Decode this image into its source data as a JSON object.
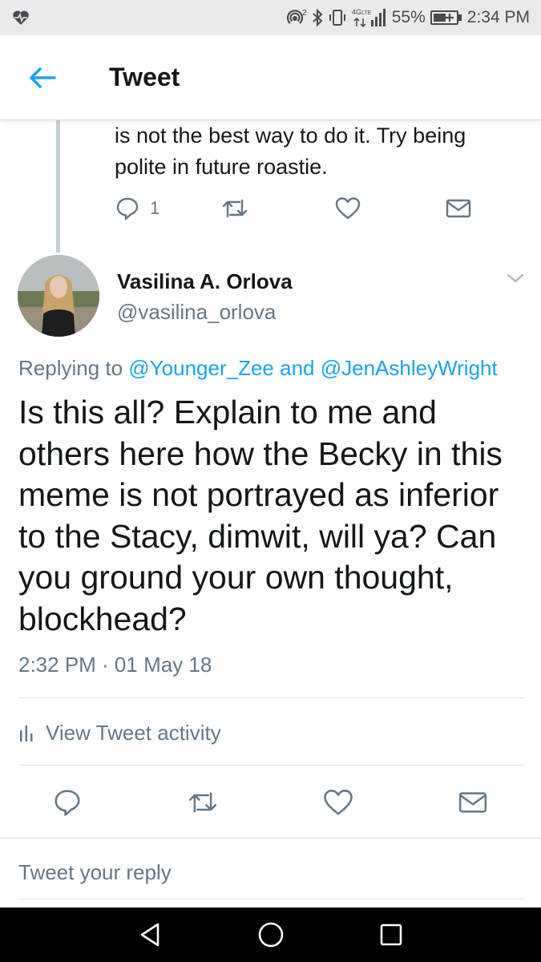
{
  "status_bar": {
    "network": "4G LTE",
    "battery": "55%",
    "time": "2:34 PM",
    "left_icon": "heart-pulse-icon"
  },
  "header": {
    "title": "Tweet",
    "back_icon": "arrow-left-icon"
  },
  "previous_tweet": {
    "text_line1": "is not the best way to do it. Try being",
    "text_line2": "polite in future roastie.",
    "reply_count": "1"
  },
  "tweet": {
    "author_name": "Vasilina A. Orlova",
    "author_handle": "@vasilina_orlova",
    "replying_prefix": "Replying to ",
    "mention_1": "@Younger_Zee",
    "replying_and": " and ",
    "mention_2": "@JenAshleyWright",
    "body_lines": [
      "Is this all? Explain to me and",
      "others here how the Becky in this",
      "meme is not portrayed as inferior",
      "to the Stacy, dimwit, will ya? Can",
      "you ground your own thought,",
      "blockhead?"
    ],
    "timestamp": "2:32 PM · 01 May 18",
    "activity_label": "View Tweet activity"
  },
  "composer": {
    "placeholder": "Tweet your reply"
  },
  "colors": {
    "accent": "#1da1f2",
    "secondary_text": "#657786",
    "primary_text": "#14171a",
    "divider": "#e1e8ed"
  }
}
